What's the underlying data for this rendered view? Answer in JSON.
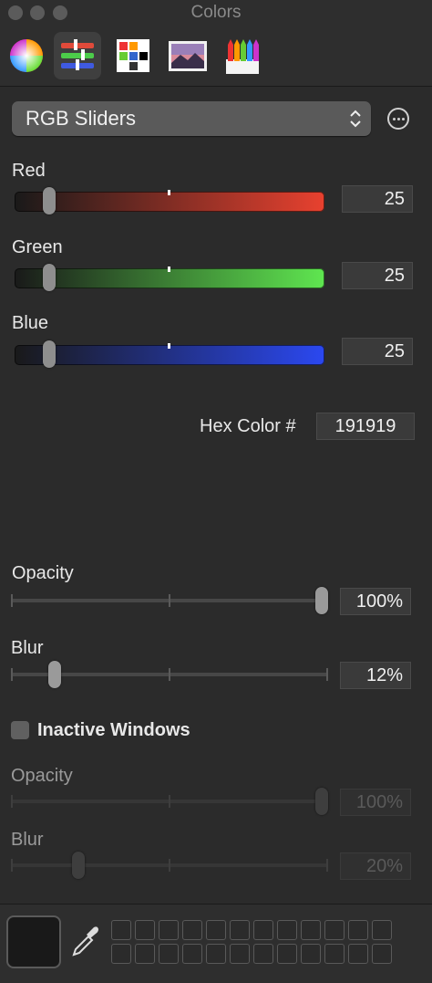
{
  "window": {
    "title": "Colors"
  },
  "toolbar": {
    "items": [
      {
        "name": "color-wheel",
        "selected": false
      },
      {
        "name": "color-sliders",
        "selected": true
      },
      {
        "name": "color-palettes",
        "selected": false
      },
      {
        "name": "image-palettes",
        "selected": false
      },
      {
        "name": "pencils",
        "selected": false
      }
    ]
  },
  "mode_popup": {
    "label": "RGB Sliders"
  },
  "sliders": {
    "red": {
      "label": "Red",
      "value": "25",
      "fraction": 0.098,
      "color_end": "#e8412f"
    },
    "green": {
      "label": "Green",
      "value": "25",
      "fraction": 0.098,
      "color_end": "#5fe650"
    },
    "blue": {
      "label": "Blue",
      "value": "25",
      "fraction": 0.098,
      "color_end": "#2b48f0"
    }
  },
  "hex": {
    "label": "Hex Color #",
    "value": "191919"
  },
  "active": {
    "opacity": {
      "label": "Opacity",
      "value": "100%",
      "fraction": 1.0
    },
    "blur": {
      "label": "Blur",
      "value": "12%",
      "fraction": 0.12
    }
  },
  "inactive_windows": {
    "label": "Inactive Windows",
    "checked": false,
    "opacity": {
      "label": "Opacity",
      "value": "100%",
      "fraction": 1.0
    },
    "blur": {
      "label": "Blur",
      "value": "20%",
      "fraction": 0.2
    }
  },
  "current_color": "#191919"
}
